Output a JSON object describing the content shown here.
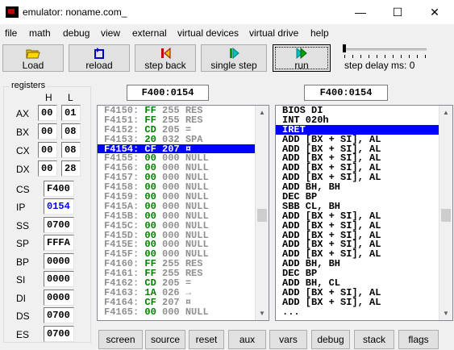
{
  "window": {
    "title": "emulator: noname.com_",
    "minimize": "—",
    "maximize": "☐",
    "close": "✕"
  },
  "menu": [
    "file",
    "math",
    "debug",
    "view",
    "external",
    "virtual devices",
    "virtual drive",
    "help"
  ],
  "toolbar": {
    "load": "Load",
    "reload": "reload",
    "step_back": "step back",
    "single_step": "single step",
    "run": "run",
    "step_delay": "step delay ms: 0",
    "step_delay_value": 0
  },
  "registers": {
    "legend": "registers",
    "h_label": "H",
    "l_label": "L",
    "byte_regs": [
      {
        "name": "AX",
        "h": "00",
        "l": "01"
      },
      {
        "name": "BX",
        "h": "00",
        "l": "08"
      },
      {
        "name": "CX",
        "h": "00",
        "l": "08"
      },
      {
        "name": "DX",
        "h": "00",
        "l": "28"
      }
    ],
    "word_regs": [
      {
        "name": "CS",
        "value": "F400"
      },
      {
        "name": "IP",
        "value": "0154"
      },
      {
        "name": "SS",
        "value": "0700"
      },
      {
        "name": "SP",
        "value": "FFFA"
      },
      {
        "name": "BP",
        "value": "0000"
      },
      {
        "name": "SI",
        "value": "0000"
      },
      {
        "name": "DI",
        "value": "0000"
      },
      {
        "name": "DS",
        "value": "0700"
      },
      {
        "name": "ES",
        "value": "0700"
      }
    ]
  },
  "memory_address": "F400:0154",
  "disasm_address": "F400:0154",
  "memory_rows": [
    {
      "addr": "F4150:",
      "hex": "FF",
      "dec": "255",
      "ch": "RES",
      "gray": true
    },
    {
      "addr": "F4151:",
      "hex": "FF",
      "dec": "255",
      "ch": "RES",
      "gray": true
    },
    {
      "addr": "F4152:",
      "hex": "CD",
      "dec": "205",
      "ch": "=",
      "gray": true
    },
    {
      "addr": "F4153:",
      "hex": "20",
      "dec": "032",
      "ch": "SPA",
      "gray": true
    },
    {
      "addr": "F4154:",
      "hex": "CF",
      "dec": "207",
      "ch": "¤",
      "sel": true
    },
    {
      "addr": "F4155:",
      "hex": "00",
      "dec": "000",
      "ch": "NULL",
      "gray": true
    },
    {
      "addr": "F4156:",
      "hex": "00",
      "dec": "000",
      "ch": "NULL",
      "gray": true
    },
    {
      "addr": "F4157:",
      "hex": "00",
      "dec": "000",
      "ch": "NULL",
      "gray": true
    },
    {
      "addr": "F4158:",
      "hex": "00",
      "dec": "000",
      "ch": "NULL",
      "gray": true
    },
    {
      "addr": "F4159:",
      "hex": "00",
      "dec": "000",
      "ch": "NULL",
      "gray": true
    },
    {
      "addr": "F415A:",
      "hex": "00",
      "dec": "000",
      "ch": "NULL",
      "gray": true
    },
    {
      "addr": "F415B:",
      "hex": "00",
      "dec": "000",
      "ch": "NULL",
      "gray": true
    },
    {
      "addr": "F415C:",
      "hex": "00",
      "dec": "000",
      "ch": "NULL",
      "gray": true
    },
    {
      "addr": "F415D:",
      "hex": "00",
      "dec": "000",
      "ch": "NULL",
      "gray": true
    },
    {
      "addr": "F415E:",
      "hex": "00",
      "dec": "000",
      "ch": "NULL",
      "gray": true
    },
    {
      "addr": "F415F:",
      "hex": "00",
      "dec": "000",
      "ch": "NULL",
      "gray": true
    },
    {
      "addr": "F4160:",
      "hex": "FF",
      "dec": "255",
      "ch": "RES",
      "gray": true
    },
    {
      "addr": "F4161:",
      "hex": "FF",
      "dec": "255",
      "ch": "RES",
      "gray": true
    },
    {
      "addr": "F4162:",
      "hex": "CD",
      "dec": "205",
      "ch": "=",
      "gray": true
    },
    {
      "addr": "F4163:",
      "hex": "1A",
      "dec": "026",
      "ch": "→",
      "gray": true
    },
    {
      "addr": "F4164:",
      "hex": "CF",
      "dec": "207",
      "ch": "¤",
      "gray": true
    },
    {
      "addr": "F4165:",
      "hex": "00",
      "dec": "000",
      "ch": "NULL",
      "gray": true
    }
  ],
  "disasm_rows": [
    {
      "text": "BIOS DI"
    },
    {
      "text": "INT 020h"
    },
    {
      "text": "IRET",
      "sel": true
    },
    {
      "text": "ADD [BX + SI], AL"
    },
    {
      "text": "ADD [BX + SI], AL"
    },
    {
      "text": "ADD [BX + SI], AL"
    },
    {
      "text": "ADD [BX + SI], AL"
    },
    {
      "text": "ADD [BX + SI], AL"
    },
    {
      "text": "ADD BH, BH"
    },
    {
      "text": "DEC BP"
    },
    {
      "text": "SBB CL, BH"
    },
    {
      "text": "ADD [BX + SI], AL"
    },
    {
      "text": "ADD [BX + SI], AL"
    },
    {
      "text": "ADD [BX + SI], AL"
    },
    {
      "text": "ADD [BX + SI], AL"
    },
    {
      "text": "ADD [BX + SI], AL"
    },
    {
      "text": "ADD BH, BH"
    },
    {
      "text": "DEC BP"
    },
    {
      "text": "ADD BH, CL"
    },
    {
      "text": "ADD [BX + SI], AL"
    },
    {
      "text": "ADD [BX + SI], AL"
    },
    {
      "text": "..."
    }
  ],
  "bottom_buttons": [
    "screen",
    "source",
    "reset",
    "aux",
    "vars",
    "debug",
    "stack",
    "flags"
  ]
}
